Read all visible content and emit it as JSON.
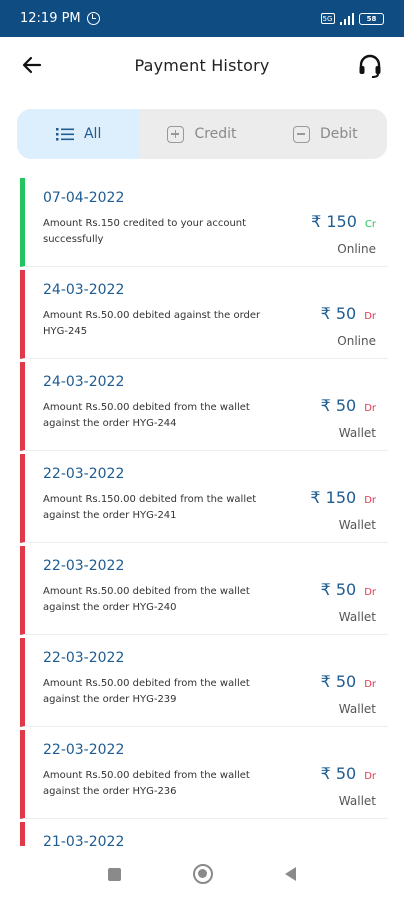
{
  "status_bar": {
    "time": "12:19 PM",
    "sim_badge": "5G",
    "battery": "58"
  },
  "header": {
    "title": "Payment History",
    "back_icon": "arrow-left-icon",
    "support_icon": "headset-icon"
  },
  "tabs": [
    {
      "label": "All",
      "icon": "list-icon",
      "active": true
    },
    {
      "label": "Credit",
      "icon": "plus-square-icon",
      "active": false
    },
    {
      "label": "Debit",
      "icon": "minus-square-icon",
      "active": false
    }
  ],
  "transactions": [
    {
      "date": "07-04-2022",
      "description": "Amount Rs.150 credited to your account successfully",
      "amount": "₹ 150",
      "type": "Cr",
      "mode": "Online"
    },
    {
      "date": "24-03-2022",
      "description": "Amount Rs.50.00 debited against the order HYG-245",
      "amount": "₹ 50",
      "type": "Dr",
      "mode": "Online"
    },
    {
      "date": "24-03-2022",
      "description": "Amount Rs.50.00 debited from the wallet against the order HYG-244",
      "amount": "₹ 50",
      "type": "Dr",
      "mode": "Wallet"
    },
    {
      "date": "22-03-2022",
      "description": "Amount Rs.150.00 debited from the wallet against the order HYG-241",
      "amount": "₹ 150",
      "type": "Dr",
      "mode": "Wallet"
    },
    {
      "date": "22-03-2022",
      "description": "Amount Rs.50.00 debited from the wallet against the order HYG-240",
      "amount": "₹ 50",
      "type": "Dr",
      "mode": "Wallet"
    },
    {
      "date": "22-03-2022",
      "description": "Amount Rs.50.00 debited from the wallet against the order HYG-239",
      "amount": "₹ 50",
      "type": "Dr",
      "mode": "Wallet"
    },
    {
      "date": "22-03-2022",
      "description": "Amount Rs.50.00 debited from the wallet against the order HYG-236",
      "amount": "₹ 50",
      "type": "Dr",
      "mode": "Wallet"
    },
    {
      "date": "21-03-2022",
      "description": "",
      "amount": "",
      "type": "",
      "mode": ""
    }
  ],
  "colors": {
    "status_bar": "#0f4c81",
    "accent": "#1e5c91",
    "credit": "#22c55e",
    "debit": "#e03a4a",
    "active_tab_bg": "#ddeefc"
  },
  "nav_bar": {
    "icons": [
      "recent-apps-icon",
      "home-icon",
      "back-triangle-icon"
    ]
  }
}
